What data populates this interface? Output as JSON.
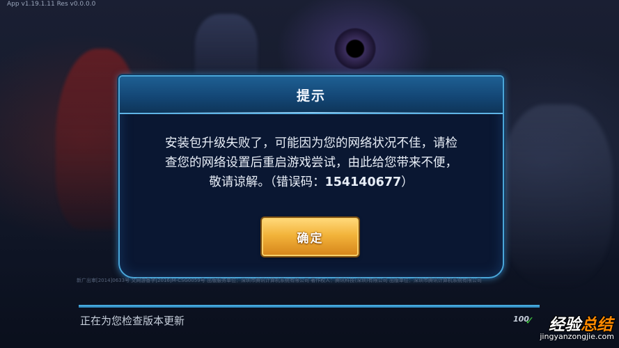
{
  "version_info": "App v1.19.1.11  Res v0.0.0.0",
  "dialog": {
    "title": "提示",
    "message_lines": [
      "安装包升级失败了，可能因为您的网络状况不佳，请检",
      "查您的网络设置后重启游戏尝试，由此给您带来不便，"
    ],
    "message_last_prefix": "敬请谅解。（错误码：",
    "error_code": "154140677",
    "message_last_suffix": "）",
    "confirm_label": "确定"
  },
  "copyright": "新广出审[2014]0633号   文网游备字[2016]M-CSG0059号   出版服务单位：深圳市腾讯计算机系统有限公司   著作权人：腾讯科技(深圳)有限公司   出版单位：深圳市腾讯计算机系统有限公司",
  "update": {
    "status": "正在为您检查版本更新",
    "percent_text": "100",
    "progress": 1.0
  },
  "watermark": {
    "text_part1": "经验",
    "text_part2": "总结",
    "url": "jingyanzongjie.com"
  },
  "colors": {
    "dialog_border": "#4aa6d8",
    "button_gold": "#f2b33a",
    "progress": "#4fb6e8"
  }
}
